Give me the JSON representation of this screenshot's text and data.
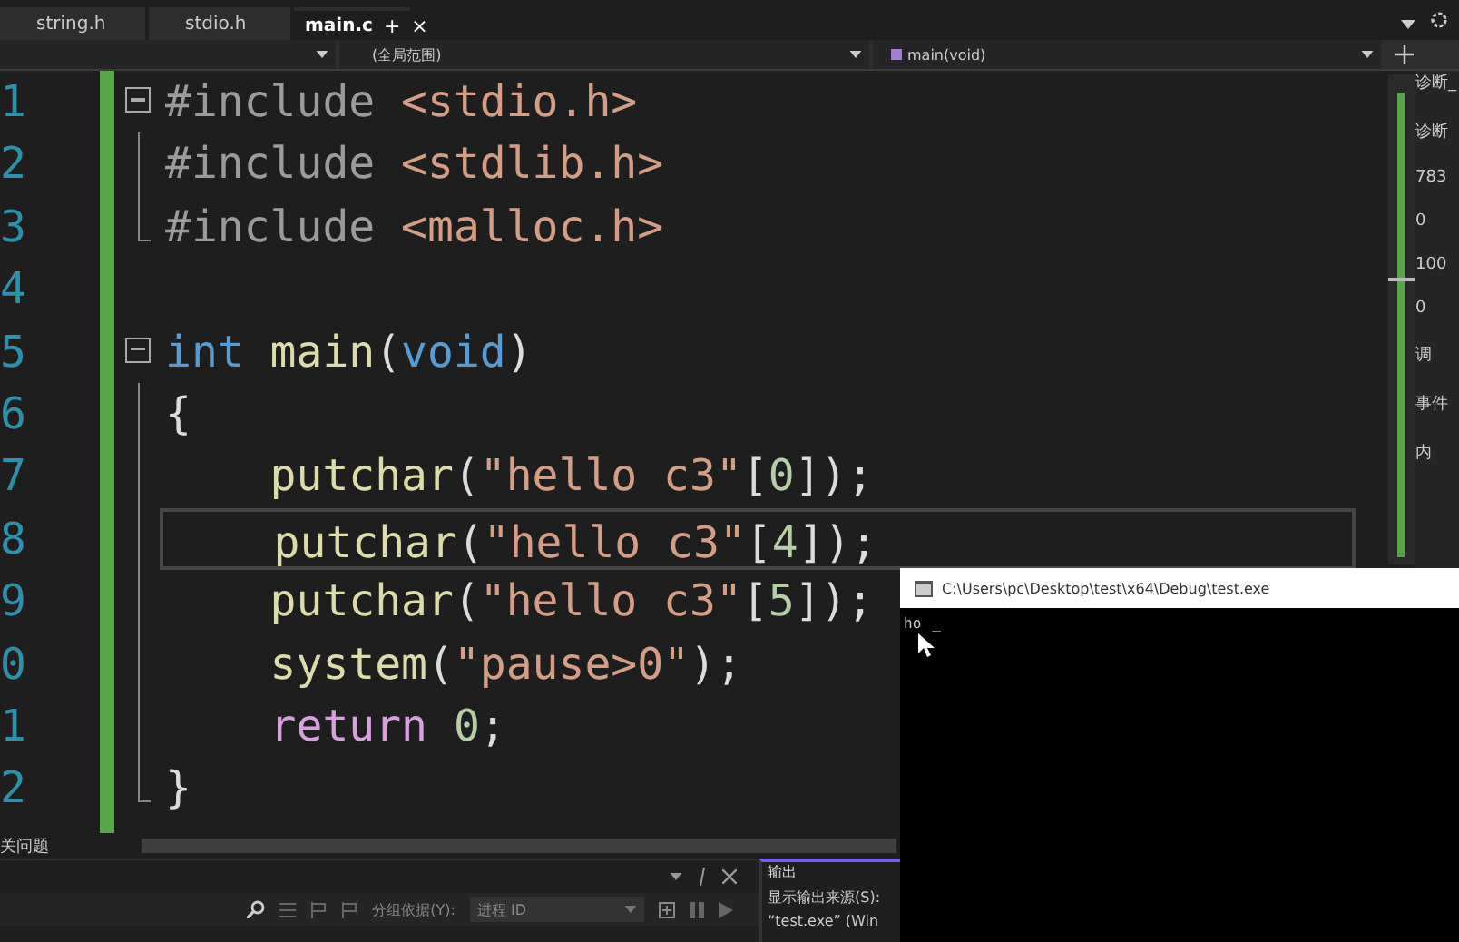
{
  "tabs": [
    {
      "label": "string.h",
      "selected": false
    },
    {
      "label": "stdio.h",
      "selected": false
    },
    {
      "label": "main.c",
      "selected": true,
      "pin": "+",
      "close": "×"
    }
  ],
  "navbar": {
    "scope": "(全局范围)",
    "function": "main(void)"
  },
  "code": {
    "lines": [
      {
        "number": "1",
        "kind": "fold-start",
        "indented": false,
        "current": false,
        "tokens": [
          {
            "text": "#include ",
            "kind": "directive"
          },
          {
            "text": "<stdio.h>",
            "kind": "string"
          }
        ]
      },
      {
        "number": "2",
        "kind": "fold-body",
        "indented": false,
        "current": false,
        "tokens": [
          {
            "text": "#include ",
            "kind": "directive"
          },
          {
            "text": "<stdlib.h>",
            "kind": "string"
          }
        ]
      },
      {
        "number": "3",
        "kind": "fold-end",
        "indented": false,
        "current": false,
        "tokens": [
          {
            "text": "#include ",
            "kind": "directive"
          },
          {
            "text": "<malloc.h>",
            "kind": "string"
          }
        ]
      },
      {
        "number": "4",
        "kind": "plain",
        "current": false
      },
      {
        "number": "5",
        "kind": "fold-start",
        "indented": false,
        "current": false,
        "tokens": [
          {
            "text": "int ",
            "kind": "keyword"
          },
          {
            "text": "main",
            "kind": "func"
          },
          {
            "text": "(",
            "kind": "plain"
          },
          {
            "text": "void",
            "kind": "keyword"
          },
          {
            "text": ")",
            "kind": "plain"
          }
        ]
      },
      {
        "number": "6",
        "kind": "fold-body",
        "indented": false,
        "current": false,
        "tokens": [
          {
            "text": "{",
            "kind": "plain"
          }
        ]
      },
      {
        "number": "7",
        "kind": "fold-body",
        "indented": true,
        "current": false,
        "tokens": [
          {
            "text": "putchar",
            "kind": "func"
          },
          {
            "text": "(",
            "kind": "plain"
          },
          {
            "text": "\"hello c3\"",
            "kind": "string"
          },
          {
            "text": "[",
            "kind": "plain"
          },
          {
            "text": "0",
            "kind": "number"
          },
          {
            "text": "]);",
            "kind": "plain"
          }
        ]
      },
      {
        "number": "8",
        "kind": "fold-body",
        "indented": true,
        "current": true,
        "tokens": [
          {
            "text": "putchar",
            "kind": "func"
          },
          {
            "text": "(",
            "kind": "plain"
          },
          {
            "text": "\"hello c3\"",
            "kind": "string"
          },
          {
            "text": "[",
            "kind": "plain"
          },
          {
            "text": "4",
            "kind": "number"
          },
          {
            "text": "]);",
            "kind": "plain"
          }
        ]
      },
      {
        "number": "9",
        "kind": "fold-body",
        "indented": true,
        "current": false,
        "tokens": [
          {
            "text": "putchar",
            "kind": "func"
          },
          {
            "text": "(",
            "kind": "plain"
          },
          {
            "text": "\"hello c3\"",
            "kind": "string"
          },
          {
            "text": "[",
            "kind": "plain"
          },
          {
            "text": "5",
            "kind": "number"
          },
          {
            "text": "]);",
            "kind": "plain"
          }
        ]
      },
      {
        "number": "0",
        "kind": "fold-body",
        "indented": true,
        "current": false,
        "tokens": [
          {
            "text": "system",
            "kind": "func"
          },
          {
            "text": "(",
            "kind": "plain"
          },
          {
            "text": "\"pause>0\"",
            "kind": "string"
          },
          {
            "text": ");",
            "kind": "plain"
          }
        ]
      },
      {
        "number": "1",
        "kind": "fold-body",
        "indented": true,
        "current": false,
        "tokens": [
          {
            "text": "return ",
            "kind": "control"
          },
          {
            "text": "0",
            "kind": "number"
          },
          {
            "text": ";",
            "kind": "plain"
          }
        ]
      },
      {
        "number": "2",
        "kind": "fold-end",
        "indented": false,
        "current": false,
        "tokens": [
          {
            "text": "}",
            "kind": "plain"
          }
        ]
      }
    ]
  },
  "side_panel": {
    "title": "诊断_",
    "items": [
      "诊断",
      "783",
      "0",
      "100",
      "0",
      "调",
      "事件",
      "内"
    ]
  },
  "status_text": "关问题",
  "bottom_panel": {
    "group_label": "分组依据(Y):",
    "group_value": "进程 ID"
  },
  "output_panel": {
    "tab": "输出",
    "source_label": "显示输出来源(S):",
    "line": "“test.exe” (Win"
  },
  "console": {
    "title": "C:\\Users\\pc\\Desktop\\test\\x64\\Debug\\test.exe",
    "output": "ho",
    "cursor": "_"
  }
}
